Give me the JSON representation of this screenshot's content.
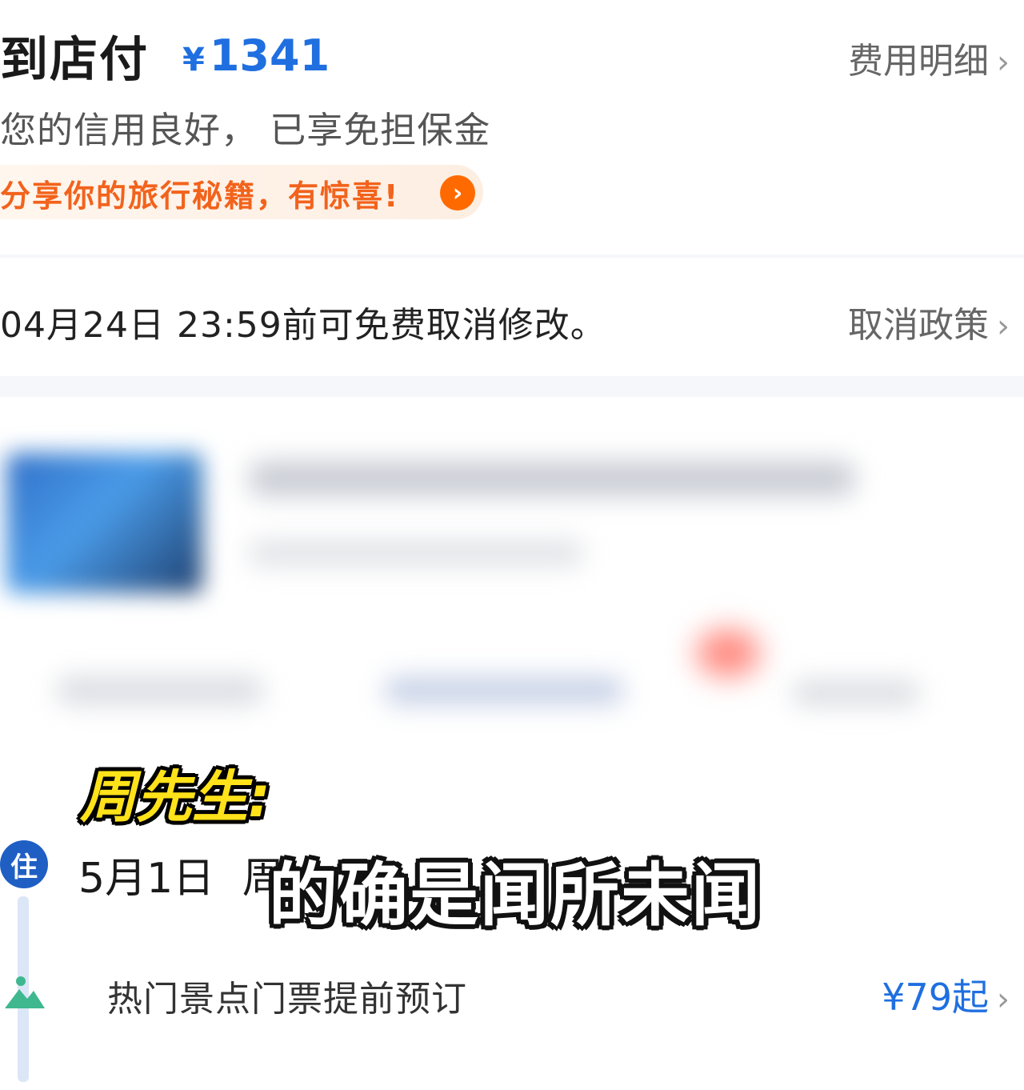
{
  "payment": {
    "label": "到店付",
    "currency": "¥",
    "amount": "1341",
    "fee_detail_link": "费用明细",
    "credit_text": "您的信用良好， 已享免担保金",
    "promo_text": "分享你的旅行秘籍，有惊喜!"
  },
  "cancellation": {
    "text": "04月24日 23:59前可免费取消修改。",
    "policy_link": "取消政策"
  },
  "stay": {
    "badge": "住",
    "date": "5月1日",
    "date_suffix": "周"
  },
  "ticket": {
    "text": "热门景点门票提前预订",
    "price": "¥79起"
  },
  "captions": {
    "speaker": "周先生:",
    "line": "的确是闻所未闻"
  },
  "colors": {
    "accent_blue": "#1f6fe0",
    "promo_orange": "#f2631c",
    "caption_yellow": "#ffe21a"
  },
  "icons": [
    "chevron-right-icon",
    "arrow-circle-icon",
    "mountain-icon"
  ]
}
